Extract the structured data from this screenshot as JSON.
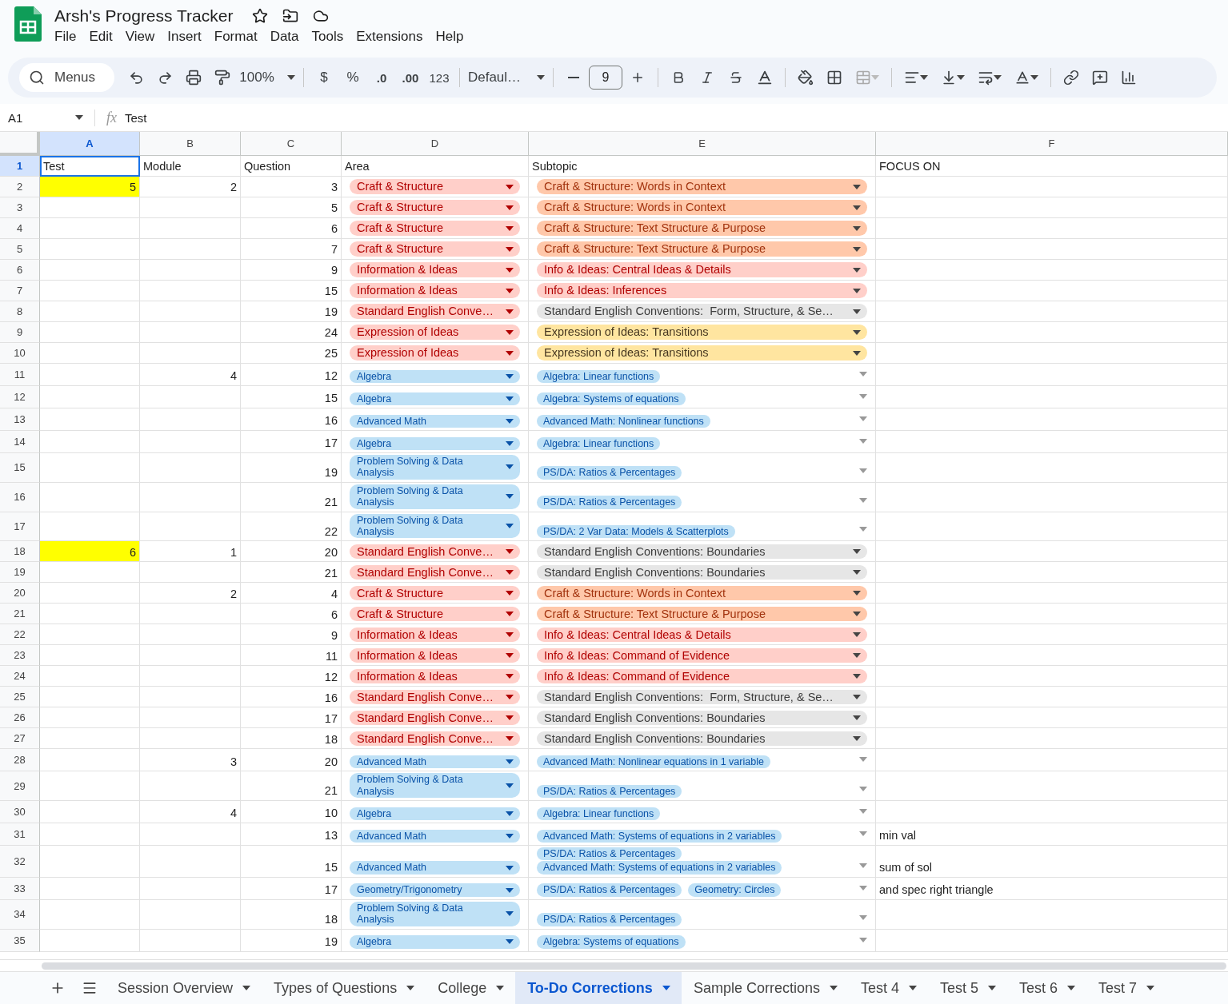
{
  "title": "Arsh's Progress Tracker",
  "menu": [
    "File",
    "Edit",
    "View",
    "Insert",
    "Format",
    "Data",
    "Tools",
    "Extensions",
    "Help"
  ],
  "toolbar": {
    "search_placeholder": "Menus",
    "zoom": "100%",
    "currency": "$",
    "percent": "%",
    "decrease_decimals": ".0",
    "increase_decimals": ".00",
    "number_format": "123",
    "font": "Defaul…",
    "font_size": "9"
  },
  "formula_bar": {
    "cell": "A1",
    "fx": "fx",
    "value": "Test"
  },
  "columns": [
    {
      "label": "A",
      "selected": true
    },
    {
      "label": "B",
      "selected": false
    },
    {
      "label": "C",
      "selected": false
    },
    {
      "label": "D",
      "selected": false
    },
    {
      "label": "E",
      "selected": false
    },
    {
      "label": "F",
      "selected": false
    }
  ],
  "header_row": {
    "number": "1",
    "selected": true,
    "cells": [
      "Test",
      "Module",
      "Question",
      "Area",
      "Subtopic",
      "FOCUS ON"
    ]
  },
  "rows": [
    {
      "number": "2",
      "selected": false,
      "test": {
        "text": "5",
        "color": "#ffff00"
      },
      "module": "2",
      "question": "3",
      "area": {
        "text": "Craft & Structure",
        "kind": "reading"
      },
      "subtopic": {
        "kind": "reading",
        "chips": [
          {
            "text": "Craft & Structure: Words in Context",
            "color": "#ffc8aa"
          }
        ]
      }
    },
    {
      "number": "3",
      "selected": false,
      "question": "5",
      "area": {
        "text": "Craft & Structure",
        "kind": "reading"
      },
      "subtopic": {
        "kind": "reading",
        "chips": [
          {
            "text": "Craft & Structure: Words in Context",
            "color": "#ffc8aa"
          }
        ]
      }
    },
    {
      "number": "4",
      "selected": false,
      "question": "6",
      "area": {
        "text": "Craft & Structure",
        "kind": "reading"
      },
      "subtopic": {
        "kind": "reading",
        "chips": [
          {
            "text": "Craft & Structure: Text Structure & Purpose",
            "color": "#ffc8aa"
          }
        ]
      }
    },
    {
      "number": "5",
      "selected": false,
      "question": "7",
      "area": {
        "text": "Craft & Structure",
        "kind": "reading"
      },
      "subtopic": {
        "kind": "reading",
        "chips": [
          {
            "text": "Craft & Structure: Text Structure & Purpose",
            "color": "#ffc8aa"
          }
        ]
      }
    },
    {
      "number": "6",
      "selected": false,
      "question": "9",
      "area": {
        "text": "Information & Ideas",
        "kind": "reading"
      },
      "subtopic": {
        "kind": "reading",
        "chips": [
          {
            "text": "Info & Ideas: Central Ideas & Details",
            "color": "#ffcfc9"
          }
        ]
      }
    },
    {
      "number": "7",
      "selected": false,
      "question": "15",
      "area": {
        "text": "Information & Ideas",
        "kind": "reading"
      },
      "subtopic": {
        "kind": "reading",
        "chips": [
          {
            "text": "Info & Ideas: Inferences",
            "color": "#ffcfc9"
          }
        ]
      }
    },
    {
      "number": "8",
      "selected": false,
      "question": "19",
      "area": {
        "text": "Standard English Conve…",
        "kind": "reading"
      },
      "subtopic": {
        "kind": "reading",
        "chips": [
          {
            "text": "Standard English Conventions:  Form, Structure, & Se…",
            "color": "#e6e6e6"
          }
        ]
      }
    },
    {
      "number": "9",
      "selected": false,
      "question": "24",
      "area": {
        "text": "Expression of Ideas",
        "kind": "reading"
      },
      "subtopic": {
        "kind": "reading",
        "chips": [
          {
            "text": "Expression of Ideas: Transitions",
            "color": "#ffe5a0"
          }
        ]
      }
    },
    {
      "number": "10",
      "selected": false,
      "question": "25",
      "area": {
        "text": "Expression of Ideas",
        "kind": "reading"
      },
      "subtopic": {
        "kind": "reading",
        "chips": [
          {
            "text": "Expression of Ideas: Transitions",
            "color": "#ffe5a0"
          }
        ]
      }
    },
    {
      "number": "11",
      "selected": false,
      "module": "4",
      "question": "12",
      "area": {
        "text": "Algebra",
        "kind": "math"
      },
      "subtopic": {
        "kind": "math",
        "chips": [
          {
            "text": "Algebra: Linear functions",
            "color": "#bfe1f6"
          }
        ]
      }
    },
    {
      "number": "12",
      "selected": false,
      "question": "15",
      "area": {
        "text": "Algebra",
        "kind": "math"
      },
      "subtopic": {
        "kind": "math",
        "chips": [
          {
            "text": "Algebra: Systems of equations",
            "color": "#bfe1f6"
          }
        ]
      }
    },
    {
      "number": "13",
      "selected": false,
      "question": "16",
      "area": {
        "text": "Advanced Math",
        "kind": "math"
      },
      "subtopic": {
        "kind": "math",
        "chips": [
          {
            "text": "Advanced Math: Nonlinear functions",
            "color": "#bfe1f6"
          }
        ]
      }
    },
    {
      "number": "14",
      "selected": false,
      "question": "17",
      "area": {
        "text": "Algebra",
        "kind": "math"
      },
      "subtopic": {
        "kind": "math",
        "chips": [
          {
            "text": "Algebra: Linear functions",
            "color": "#bfe1f6"
          }
        ]
      }
    },
    {
      "number": "15",
      "selected": false,
      "question": "19",
      "area": {
        "text": "Problem Solving & Data Analysis",
        "kind": "math"
      },
      "subtopic": {
        "kind": "math",
        "chips": [
          {
            "text": "PS/DA: Ratios & Percentages",
            "color": "#bfe1f6"
          }
        ]
      }
    },
    {
      "number": "16",
      "selected": false,
      "question": "21",
      "area": {
        "text": "Problem Solving & Data Analysis",
        "kind": "math"
      },
      "subtopic": {
        "kind": "math",
        "chips": [
          {
            "text": "PS/DA: Ratios & Percentages",
            "color": "#bfe1f6"
          }
        ]
      }
    },
    {
      "number": "17",
      "selected": false,
      "question": "22",
      "area": {
        "text": "Problem Solving & Data Analysis",
        "kind": "math"
      },
      "subtopic": {
        "kind": "math",
        "chips": [
          {
            "text": "PS/DA: 2 Var Data: Models & Scatterplots",
            "color": "#bfe1f6"
          }
        ]
      }
    },
    {
      "number": "18",
      "selected": false,
      "test": {
        "text": "6",
        "color": "#ffff00"
      },
      "module": "1",
      "question": "20",
      "area": {
        "text": "Standard English Conve…",
        "kind": "reading"
      },
      "subtopic": {
        "kind": "reading",
        "chips": [
          {
            "text": "Standard English Conventions: Boundaries",
            "color": "#e6e6e6"
          }
        ]
      }
    },
    {
      "number": "19",
      "selected": false,
      "question": "21",
      "area": {
        "text": "Standard English Conve…",
        "kind": "reading"
      },
      "subtopic": {
        "kind": "reading",
        "chips": [
          {
            "text": "Standard English Conventions: Boundaries",
            "color": "#e6e6e6"
          }
        ]
      }
    },
    {
      "number": "20",
      "selected": false,
      "module": "2",
      "question": "4",
      "area": {
        "text": "Craft & Structure",
        "kind": "reading"
      },
      "subtopic": {
        "kind": "reading",
        "chips": [
          {
            "text": "Craft & Structure: Words in Context",
            "color": "#ffc8aa"
          }
        ]
      }
    },
    {
      "number": "21",
      "selected": false,
      "question": "6",
      "area": {
        "text": "Craft & Structure",
        "kind": "reading"
      },
      "subtopic": {
        "kind": "reading",
        "chips": [
          {
            "text": "Craft & Structure: Text Structure & Purpose",
            "color": "#ffc8aa"
          }
        ]
      }
    },
    {
      "number": "22",
      "selected": false,
      "question": "9",
      "area": {
        "text": "Information & Ideas",
        "kind": "reading"
      },
      "subtopic": {
        "kind": "reading",
        "chips": [
          {
            "text": "Info & Ideas: Central Ideas & Details",
            "color": "#ffcfc9"
          }
        ]
      }
    },
    {
      "number": "23",
      "selected": false,
      "question": "11",
      "area": {
        "text": "Information & Ideas",
        "kind": "reading"
      },
      "subtopic": {
        "kind": "reading",
        "chips": [
          {
            "text": "Info & Ideas: Command of Evidence",
            "color": "#ffcfc9"
          }
        ]
      }
    },
    {
      "number": "24",
      "selected": false,
      "question": "12",
      "area": {
        "text": "Information & Ideas",
        "kind": "reading"
      },
      "subtopic": {
        "kind": "reading",
        "chips": [
          {
            "text": "Info & Ideas: Command of Evidence",
            "color": "#ffcfc9"
          }
        ]
      }
    },
    {
      "number": "25",
      "selected": false,
      "question": "16",
      "area": {
        "text": "Standard English Conve…",
        "kind": "reading"
      },
      "subtopic": {
        "kind": "reading",
        "chips": [
          {
            "text": "Standard English Conventions:  Form, Structure, & Se…",
            "color": "#e6e6e6"
          }
        ]
      }
    },
    {
      "number": "26",
      "selected": false,
      "question": "17",
      "area": {
        "text": "Standard English Conve…",
        "kind": "reading"
      },
      "subtopic": {
        "kind": "reading",
        "chips": [
          {
            "text": "Standard English Conventions: Boundaries",
            "color": "#e6e6e6"
          }
        ]
      }
    },
    {
      "number": "27",
      "selected": false,
      "question": "18",
      "area": {
        "text": "Standard English Conve…",
        "kind": "reading"
      },
      "subtopic": {
        "kind": "reading",
        "chips": [
          {
            "text": "Standard English Conventions: Boundaries",
            "color": "#e6e6e6"
          }
        ]
      }
    },
    {
      "number": "28",
      "selected": false,
      "module": "3",
      "question": "20",
      "area": {
        "text": "Advanced Math",
        "kind": "math"
      },
      "subtopic": {
        "kind": "math",
        "chips": [
          {
            "text": "Advanced Math: Nonlinear equations in 1 variable",
            "color": "#bfe1f6"
          }
        ]
      }
    },
    {
      "number": "29",
      "selected": false,
      "question": "21",
      "area": {
        "text": "Problem Solving & Data Analysis",
        "kind": "math"
      },
      "subtopic": {
        "kind": "math",
        "chips": [
          {
            "text": "PS/DA: Ratios & Percentages",
            "color": "#bfe1f6"
          }
        ]
      }
    },
    {
      "number": "30",
      "selected": false,
      "module": "4",
      "question": "10",
      "area": {
        "text": "Algebra",
        "kind": "math"
      },
      "subtopic": {
        "kind": "math",
        "chips": [
          {
            "text": "Algebra: Linear functions",
            "color": "#bfe1f6"
          }
        ]
      }
    },
    {
      "number": "31",
      "selected": false,
      "question": "13",
      "area": {
        "text": "Advanced Math",
        "kind": "math"
      },
      "subtopic": {
        "kind": "math",
        "chips": [
          {
            "text": "Advanced Math: Systems of equations in 2 variables",
            "color": "#bfe1f6"
          }
        ]
      },
      "focus": "min val"
    },
    {
      "number": "32",
      "selected": false,
      "question": "15",
      "area": {
        "text": "Advanced Math",
        "kind": "math"
      },
      "subtopic": {
        "kind": "math",
        "chips": [
          {
            "text": "PS/DA: Ratios & Percentages",
            "color": "#bfe1f6"
          },
          {
            "text": "Advanced Math: Systems of equations in 2 variables",
            "color": "#bfe1f6"
          }
        ]
      },
      "focus": "sum of sol"
    },
    {
      "number": "33",
      "selected": false,
      "question": "17",
      "area": {
        "text": "Geometry/Trigonometry",
        "kind": "math"
      },
      "subtopic": {
        "kind": "math",
        "chips": [
          {
            "text": "PS/DA: Ratios & Percentages",
            "color": "#bfe1f6"
          },
          {
            "text": "Geometry: Circles",
            "color": "#bfe1f6"
          }
        ]
      },
      "focus": "and spec right triangle"
    },
    {
      "number": "34",
      "selected": false,
      "question": "18",
      "area": {
        "text": "Problem Solving & Data Analysis",
        "kind": "math"
      },
      "subtopic": {
        "kind": "math",
        "chips": [
          {
            "text": "PS/DA: Ratios & Percentages",
            "color": "#bfe1f6"
          }
        ]
      }
    },
    {
      "number": "35",
      "selected": false,
      "question": "19",
      "area": {
        "text": "Algebra",
        "kind": "math"
      },
      "subtopic": {
        "kind": "math",
        "chips": [
          {
            "text": "Algebra: Systems of equations",
            "color": "#bfe1f6"
          }
        ]
      }
    }
  ],
  "tabs": [
    {
      "label": "Session Overview",
      "selected": false
    },
    {
      "label": "Types of Questions",
      "selected": false
    },
    {
      "label": "College",
      "selected": false
    },
    {
      "label": "To-Do Corrections",
      "selected": true
    },
    {
      "label": "Sample Corrections",
      "selected": false
    },
    {
      "label": "Test 4",
      "selected": false
    },
    {
      "label": "Test 5",
      "selected": false
    },
    {
      "label": "Test 6",
      "selected": false
    },
    {
      "label": "Test 7",
      "selected": false
    }
  ]
}
